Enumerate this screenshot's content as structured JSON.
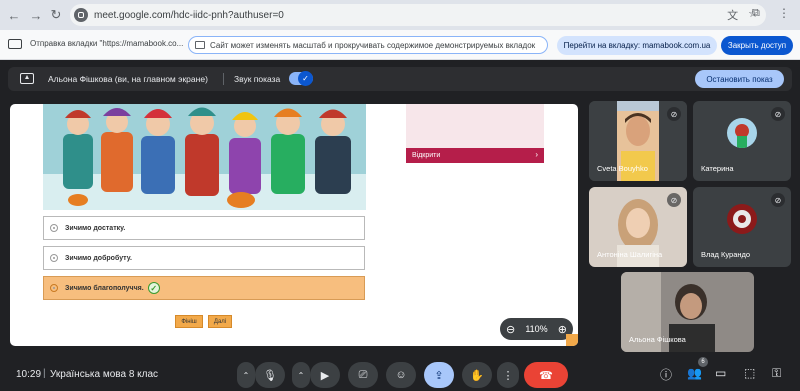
{
  "browser": {
    "url": "meet.google.com/hdc-iidc-pnh?authuser=0",
    "back_icon": "back-arrow-icon",
    "forward_icon": "forward-arrow-icon",
    "reload_icon": "reload-icon"
  },
  "sharebar": {
    "label": "Отправка вкладки \"https://mamabook.co...",
    "notice": "Сайт может изменять масштаб и прокручивать содержимое демонстрируемых вкладок",
    "goto_button": "Перейти на вкладку: mamabook.com.ua",
    "close_button": "Закрыть доступ"
  },
  "presenting": {
    "name": "Альона Фішкова (ви, на главном экране)",
    "sound_label": "Звук показа",
    "sound_on": true,
    "stop_button": "Остановить показ"
  },
  "shared_content": {
    "open_button": "Відкрити",
    "options": [
      {
        "label": "Зичимо достатку.",
        "selected": false
      },
      {
        "label": "Зичимо добробуту.",
        "selected": false
      },
      {
        "label": "Зичимо благополуччя.",
        "selected": true
      }
    ],
    "btn_finish": "Фініш",
    "btn_next": "Далі",
    "zoom_level": "110%"
  },
  "participants": [
    {
      "name": "Cveta Bouyhko",
      "muted": true
    },
    {
      "name": "Катерина",
      "muted": true
    },
    {
      "name": "Антоніна Шалигіна",
      "muted": true
    },
    {
      "name": "Влад Курандо",
      "muted": true
    },
    {
      "name": "Альона Фішкова",
      "muted": false
    }
  ],
  "bottom": {
    "time": "10:29",
    "separator": "|",
    "meeting_title": "Українська мова 8 клас",
    "people_count": "6"
  },
  "colors": {
    "meet_bg": "#202124",
    "accent_blue": "#0b57d0",
    "hangup_red": "#ea4335",
    "selected_option": "#f7be7e",
    "open_bar": "#b51e4a"
  }
}
